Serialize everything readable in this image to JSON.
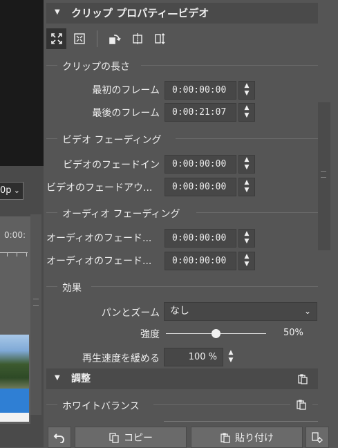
{
  "left": {
    "resolution_value": "0p",
    "timecode_label": "0:00:"
  },
  "panel": {
    "header_title": "クリップ プロパティ—ビデオ",
    "clip_length": {
      "title": "クリップの長さ",
      "first_frame_label": "最初のフレーム",
      "first_frame_value": "0:00:00:00",
      "last_frame_label": "最後のフレーム",
      "last_frame_value": "0:00:21:07"
    },
    "video_fading": {
      "title": "ビデオ フェーディング",
      "fade_in_label": "ビデオのフェードイン",
      "fade_in_value": "0:00:00:00",
      "fade_out_label": "ビデオのフェードアウ...",
      "fade_out_value": "0:00:00:00"
    },
    "audio_fading": {
      "title": "オーディオ フェーディング",
      "fade_in_label": "オーディオのフェード...",
      "fade_in_value": "0:00:00:00",
      "fade_out_label": "オーディオのフェード...",
      "fade_out_value": "0:00:00:00"
    },
    "effects": {
      "title": "効果",
      "pan_zoom_label": "パンとズーム",
      "pan_zoom_value": "なし",
      "strength_label": "強度",
      "strength_value": "50%",
      "strength_fraction": 0.5,
      "slow_speed_label": "再生速度を緩める",
      "slow_speed_value": "100 %"
    },
    "adjust_header_title": "調整",
    "white_balance_title": "ホワイトバランス",
    "buttons": {
      "copy_label": "コピー",
      "paste_label": "貼り付け"
    }
  }
}
